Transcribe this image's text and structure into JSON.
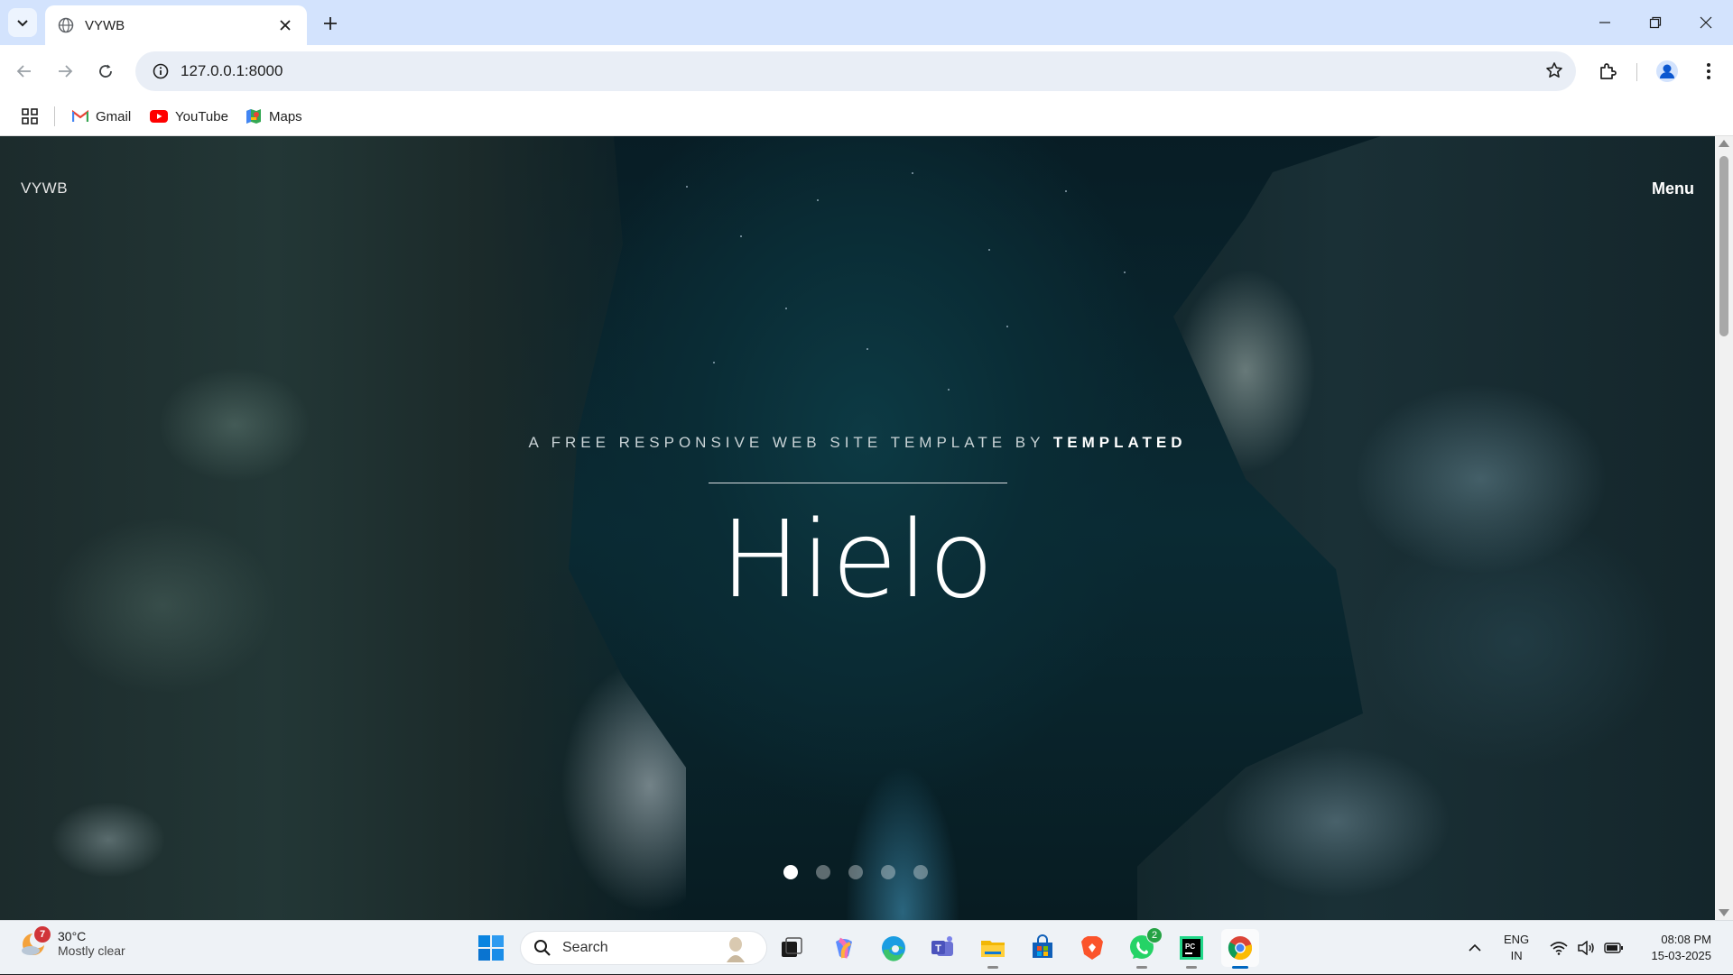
{
  "browser": {
    "tab_title": "VYWB",
    "url": "127.0.0.1:8000",
    "bookmarks": [
      {
        "label": "Gmail",
        "icon": "gmail-icon"
      },
      {
        "label": "YouTube",
        "icon": "youtube-icon"
      },
      {
        "label": "Maps",
        "icon": "maps-icon"
      }
    ]
  },
  "page": {
    "logo": "VYWB",
    "menu_label": "Menu",
    "kicker_prefix": "A FREE RESPONSIVE WEB SITE TEMPLATE BY",
    "kicker_brand": "TEMPLATED",
    "headline": "Hielo",
    "slides": 5,
    "active_slide": 1,
    "colors": {
      "overlay_text": "#ffffff",
      "background": "#0a2a33"
    }
  },
  "taskbar": {
    "weather": {
      "temp": "30°C",
      "condition": "Mostly clear",
      "badge": "7"
    },
    "search_placeholder": "Search",
    "apps": [
      {
        "name": "start-icon"
      },
      {
        "name": "task-view-icon"
      },
      {
        "name": "copilot-icon"
      },
      {
        "name": "edge-icon"
      },
      {
        "name": "teams-icon"
      },
      {
        "name": "file-explorer-icon"
      },
      {
        "name": "store-icon"
      },
      {
        "name": "brave-icon"
      },
      {
        "name": "whatsapp-icon",
        "badge": "2"
      },
      {
        "name": "pycharm-icon"
      },
      {
        "name": "chrome-icon"
      }
    ],
    "lang_line1": "ENG",
    "lang_line2": "IN",
    "time": "08:08 PM",
    "date": "15-03-2025"
  }
}
